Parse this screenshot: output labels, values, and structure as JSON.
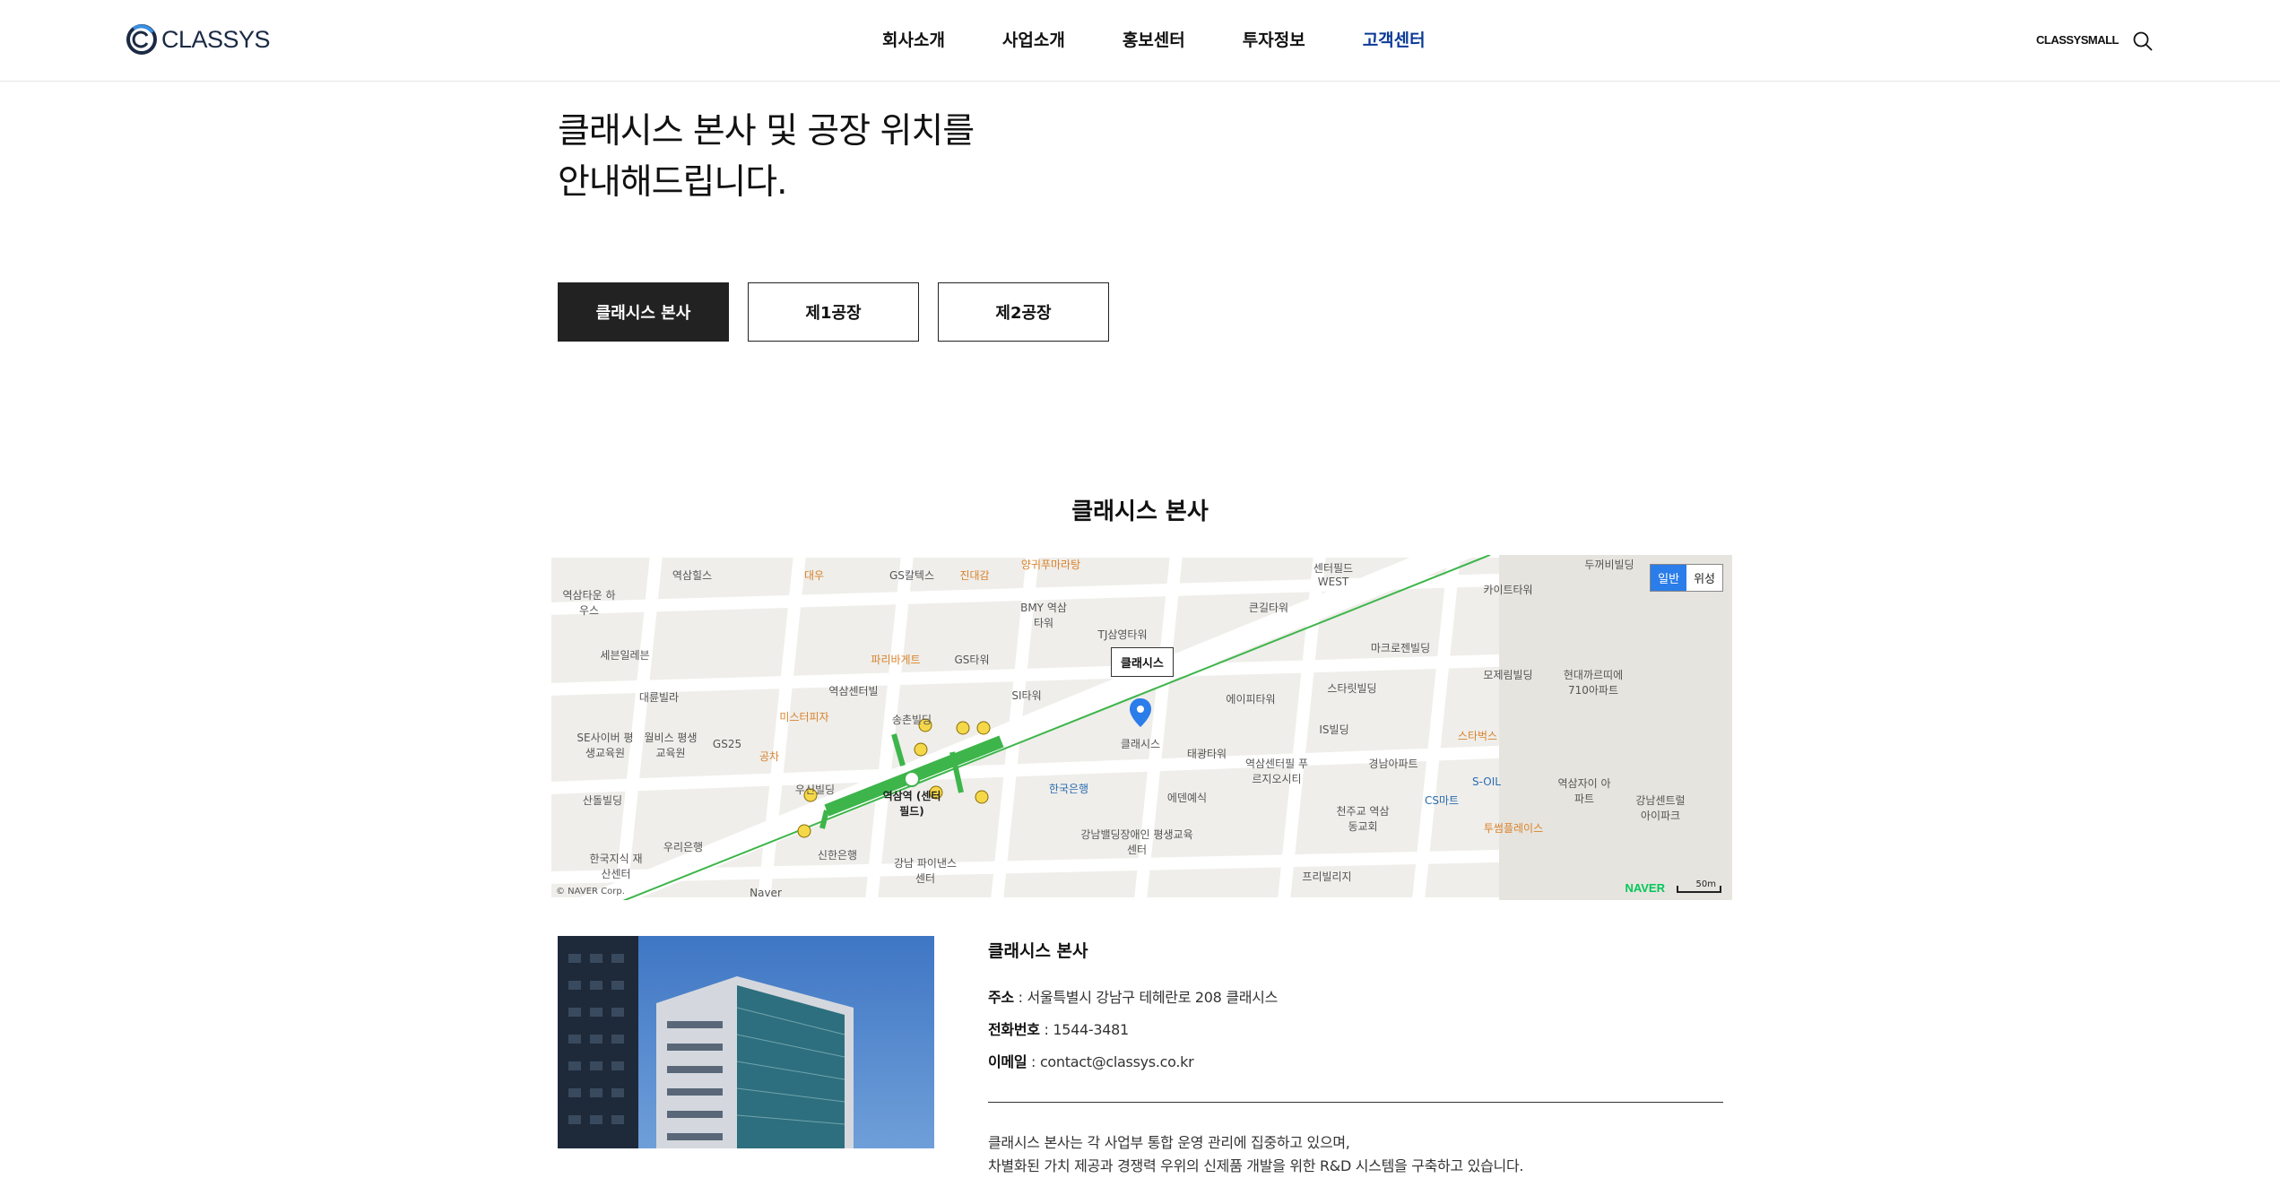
{
  "header": {
    "logo_text": "CLASSYS",
    "nav": [
      {
        "label": "회사소개",
        "active": false
      },
      {
        "label": "사업소개",
        "active": false
      },
      {
        "label": "홍보센터",
        "active": false
      },
      {
        "label": "투자정보",
        "active": false
      },
      {
        "label": "고객센터",
        "active": true
      }
    ],
    "mall_label": "CLASSYSMALL",
    "search_icon": "search-icon"
  },
  "intro": {
    "line1": "클래시스 본사 및 공장 위치를",
    "line2": "안내해드립니다."
  },
  "tabs": [
    {
      "label": "클래시스 본사",
      "active": true
    },
    {
      "label": "제1공장",
      "active": false
    },
    {
      "label": "제2공장",
      "active": false
    }
  ],
  "section_title": "클래시스 본사",
  "map": {
    "marker_label": "클래시스",
    "toggle_normal": "일반",
    "toggle_satellite": "위성",
    "brand": "NAVER",
    "scale": "50m",
    "copyright": "© NAVER Corp.",
    "pois": [
      "역삼힐스",
      "대우",
      "GS칼텍스",
      "진대감",
      "양귀푸마라탕",
      "센터필드 WEST",
      "두꺼비빌딩",
      "카이트타워",
      "역삼타운 하우스",
      "BMY 역삼타워",
      "큰길타워",
      "세븐일레븐",
      "TJ삼영타워",
      "마크로젠빌딩",
      "파리바게트",
      "GS타워",
      "역삼센터빌",
      "SI타워",
      "대륜빌라",
      "송촌빌딩",
      "미스터피자",
      "에이피타워",
      "스타릿빌딩",
      "모제림빌딩",
      "현대까르띠에 710아파트",
      "SE사이버 평생교육원",
      "월비스 평생교육원",
      "GS25",
      "공차",
      "IS빌딩",
      "스타벅스",
      "클래시스",
      "태광타워",
      "역삼센터필 푸르지오시티",
      "경남아파트",
      "우신빌딩",
      "역삼역 (센터필드)",
      "한국은행",
      "에덴예식",
      "S-OIL",
      "역삼자이 아파트",
      "강남센트럴 아이파크",
      "산돌빌딩",
      "CS마트",
      "천주교 역삼동교회",
      "투썸플레이스",
      "우리은행",
      "신한은행",
      "강남밸딩장애인 평생교육센터",
      "한국지식 재산센터",
      "강남 파이낸스센터",
      "프리빌리지",
      "Naver"
    ]
  },
  "info": {
    "title": "클래시스 본사",
    "address_label": "주소",
    "address": "서울특별시 강남구 테헤란로 208 클래시스",
    "phone_label": "전화번호",
    "phone": "1544-3481",
    "email_label": "이메일",
    "email": "contact@classys.co.kr",
    "desc_line1": "클래시스 본사는 각 사업부 통합 운영 관리에 집중하고 있으며,",
    "desc_line2": "차별화된 가치 제공과 경쟁력 우위의 신제품 개발을 위한 R&D 시스템을 구축하고 있습니다."
  },
  "colors": {
    "active_nav": "#0a3a96",
    "tab_active_bg": "#222222",
    "subway_line": "#3db54a",
    "map_toggle_active": "#2b7de9"
  }
}
